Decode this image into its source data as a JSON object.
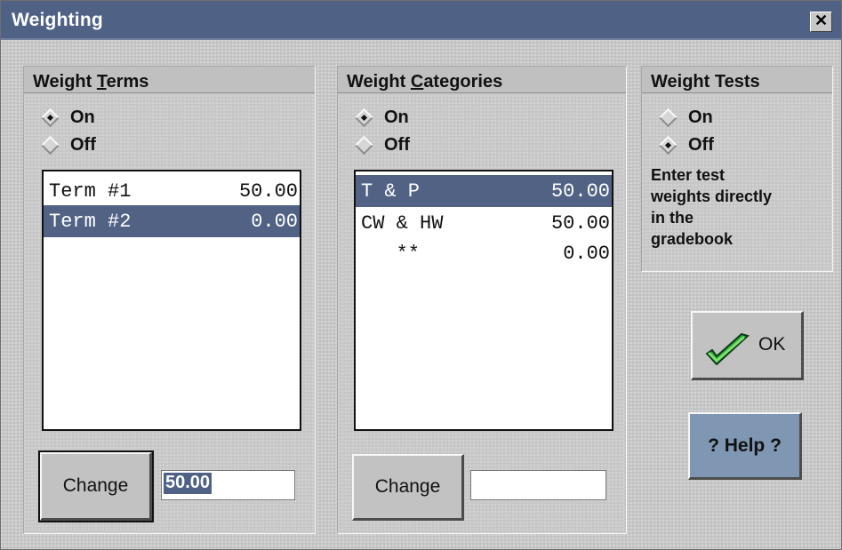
{
  "window": {
    "title": "Weighting",
    "close_glyph": "✕"
  },
  "terms": {
    "title_pre": "Weight ",
    "title_u": "T",
    "title_post": "erms",
    "radio_on": "On",
    "radio_off": "Off",
    "radio_selected": "On",
    "rows": [
      {
        "name": "Term #1",
        "value": "50.00"
      },
      {
        "name": "Term #2",
        "value": "0.00"
      }
    ],
    "selected_index": 1,
    "change_label": "Change",
    "input_value": "50.00"
  },
  "categories": {
    "title_pre": "Weight ",
    "title_u": "C",
    "title_post": "ategories",
    "radio_on": "On",
    "radio_off": "Off",
    "radio_selected": "On",
    "rows": [
      {
        "name": "T & P",
        "value": "50.00"
      },
      {
        "name": "CW & HW",
        "value": "50.00"
      },
      {
        "name": "   **",
        "value": "0.00"
      }
    ],
    "selected_index": 0,
    "change_label": "Change",
    "input_value": ""
  },
  "tests": {
    "title": "Weight Tests",
    "radio_on": "On",
    "radio_off": "Off",
    "radio_selected": "Off",
    "note_lines": [
      "Enter test",
      "weights directly",
      "in the",
      "gradebook"
    ]
  },
  "buttons": {
    "ok_label": "OK",
    "help_label": "? Help ?"
  },
  "icons": {
    "ok": "checkmark-icon",
    "close": "close-icon"
  },
  "colors": {
    "titlebar": "#4f6286",
    "selection": "#516285",
    "help_button": "#7f97b3",
    "checkmark": "#2fa33d"
  }
}
